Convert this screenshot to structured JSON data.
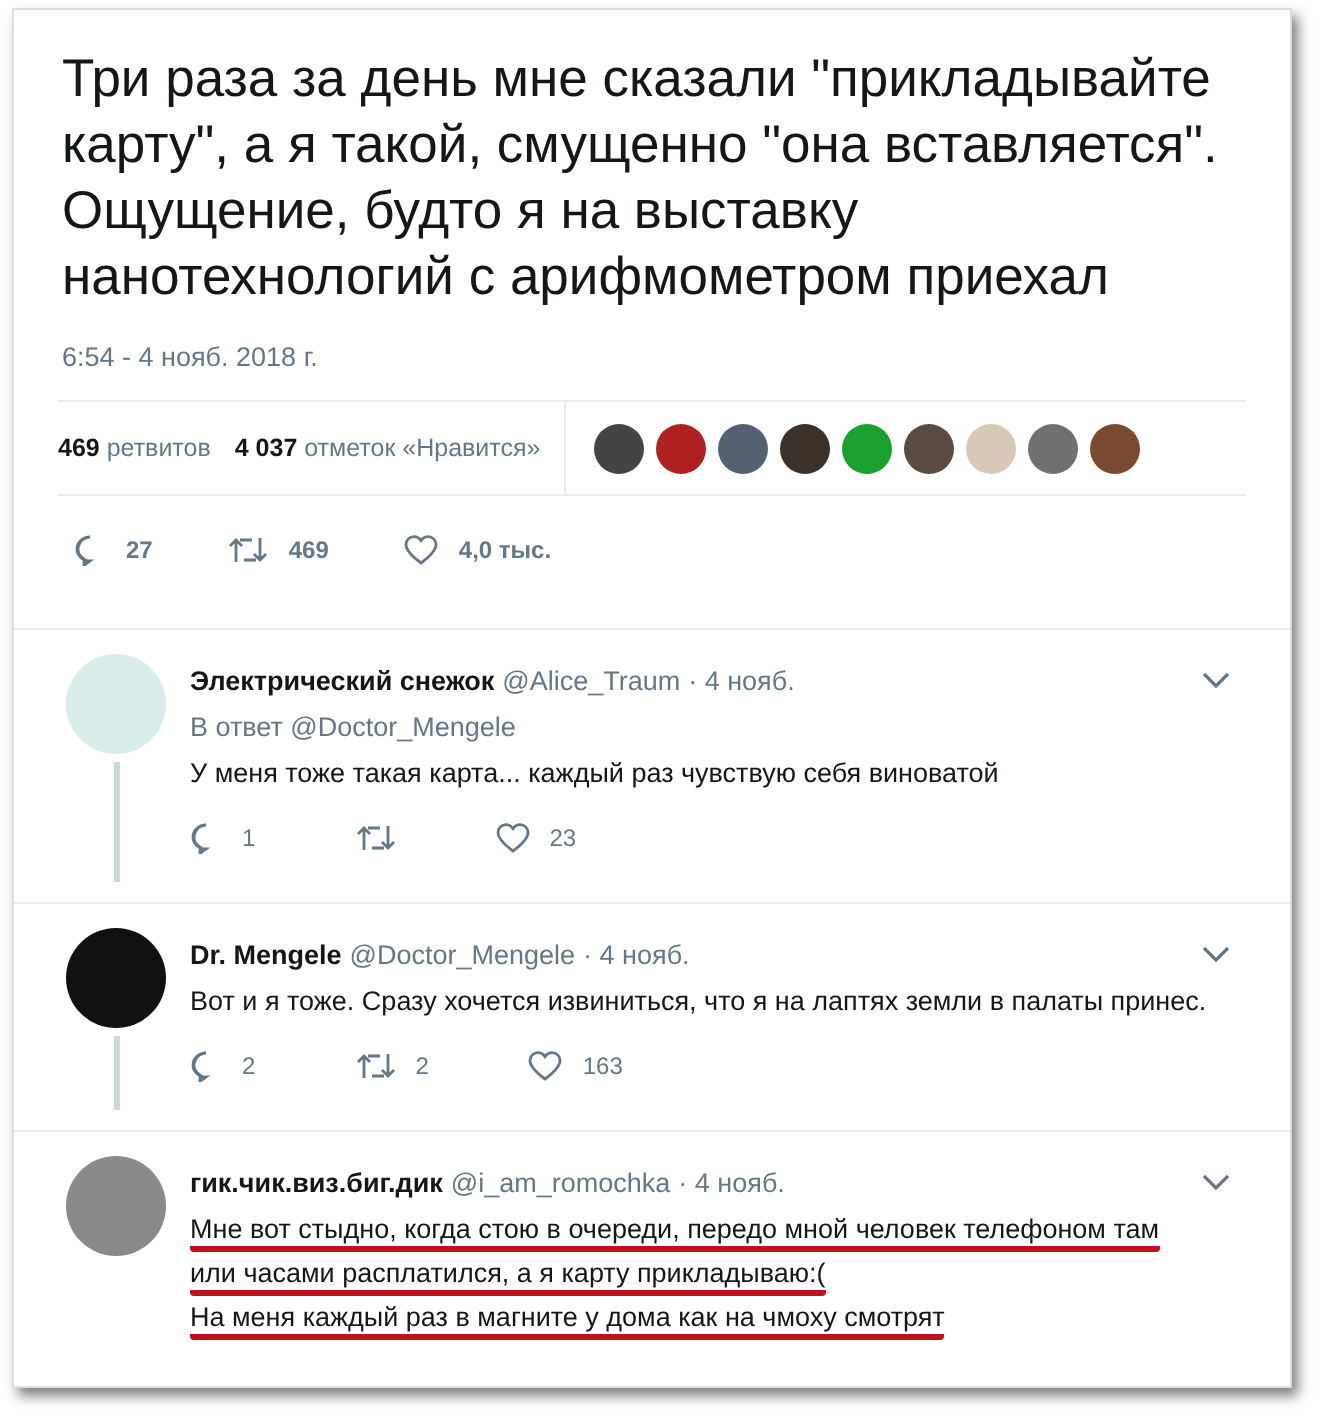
{
  "tweet": {
    "text": "Три раза за день мне сказали \"прикладывайте карту\", а я такой, смущенно \"она вставляется\". Ощущение, будто я на выставку нанотехнологий с арифмометром приехал",
    "timestamp": "6:54 - 4 нояб. 2018 г.",
    "stats": [
      {
        "count": "469",
        "label": "ретвитов"
      },
      {
        "count": "4 037",
        "label": "отметок «Нравится»"
      }
    ],
    "actions": [
      {
        "kind": "reply",
        "count": "27"
      },
      {
        "kind": "retweet",
        "count": "469"
      },
      {
        "kind": "like",
        "count": "4,0 тыс."
      }
    ]
  },
  "replies": [
    {
      "name": "Электрический снежок",
      "handle": "@Alice_Traum",
      "date": "· 4 нояб.",
      "reply_to": "В ответ @Doctor_Mengele",
      "lines": [
        {
          "text": "У меня тоже такая карта... каждый раз чувствую себя виноватой",
          "underlined": false
        }
      ],
      "actions": [
        {
          "kind": "reply",
          "count": "1"
        },
        {
          "kind": "retweet"
        },
        {
          "kind": "like",
          "count": "23"
        }
      ]
    },
    {
      "name": "Dr. Mengele",
      "handle": "@Doctor_Mengele",
      "date": "· 4 нояб.",
      "lines": [
        {
          "text": "Вот и я тоже. Сразу хочется извиниться, что я на лаптях земли  в палаты принес.",
          "underlined": false
        }
      ],
      "actions": [
        {
          "kind": "reply",
          "count": "2"
        },
        {
          "kind": "retweet",
          "count": "2"
        },
        {
          "kind": "like",
          "count": "163"
        }
      ]
    },
    {
      "name": "гик.чик.виз.биг.дик",
      "handle": "@i_am_romochka",
      "date": "· 4 нояб.",
      "lines": [
        {
          "text": "Мне вот стыдно, когда стою в очереди, передо мной человек телефоном там",
          "underlined": true
        },
        {
          "text": "или часами расплатился, а я карту прикладываю:(",
          "underlined": true
        },
        {
          "text": "На меня каждый раз в магните у дома как на чмоху смотрят",
          "underlined": true
        }
      ]
    }
  ]
}
